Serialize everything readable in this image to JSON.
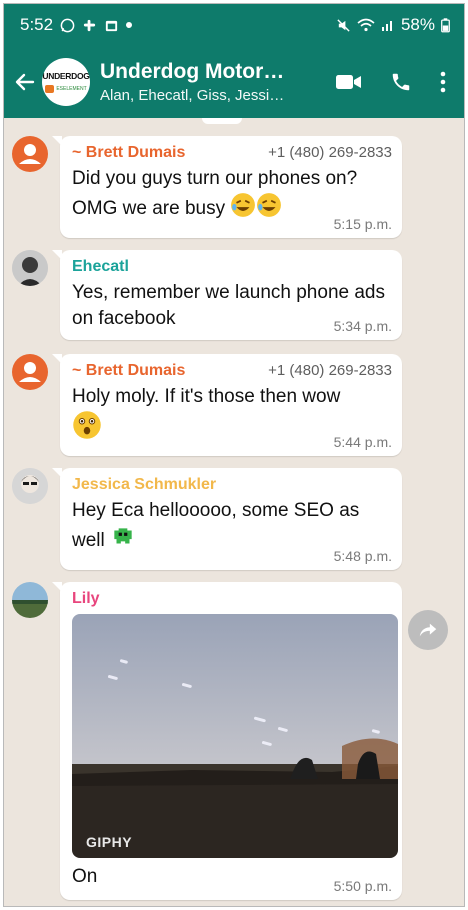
{
  "status": {
    "time": "5:52",
    "battery": "58%"
  },
  "header": {
    "title": "Underdog Motor…",
    "subtitle": "Alan, Ehecatl, Giss, Jessi…",
    "avatar_top": "UNDERDOG",
    "avatar_bottom": "ESELEMENT"
  },
  "messages": [
    {
      "sender": "~ Brett Dumais",
      "phone": "+1 (480) 269-2833",
      "text": "Did you guys turn our phones on? OMG we are busy",
      "time": "5:15 p.m.",
      "color": "#e8652e"
    },
    {
      "sender": "Ehecatl",
      "text": "Yes, remember we launch phone ads on facebook",
      "time": "5:34 p.m.",
      "color": "#1ba39a"
    },
    {
      "sender": "~ Brett Dumais",
      "phone": "+1 (480) 269-2833",
      "text": "Holy moly. If it's those then wow",
      "time": "5:44 p.m.",
      "color": "#e8652e"
    },
    {
      "sender": "Jessica Schmukler",
      "text": "Hey Eca hellooooo, some SEO as well",
      "time": "5:48 p.m.",
      "color": "#f2b84b"
    },
    {
      "sender": "Lily",
      "gif_label": "GIPHY",
      "text": "On",
      "time": "5:50 p.m.",
      "color": "#e8457d"
    }
  ],
  "colors": {
    "header_bg": "#0e7b6b",
    "chat_bg": "#ece5dd"
  }
}
